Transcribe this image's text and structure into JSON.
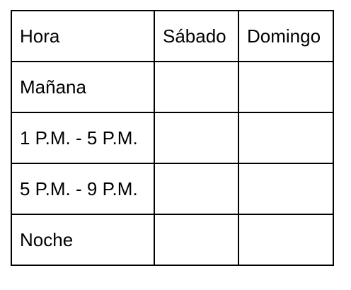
{
  "table": {
    "headers": [
      "Hora",
      "Sábado",
      "Domingo"
    ],
    "rows": [
      [
        "Mañana",
        "",
        ""
      ],
      [
        "1 P.M. - 5 P.M.",
        "",
        ""
      ],
      [
        "5 P.M. - 9 P.M.",
        "",
        ""
      ],
      [
        "Noche",
        "",
        ""
      ]
    ]
  }
}
